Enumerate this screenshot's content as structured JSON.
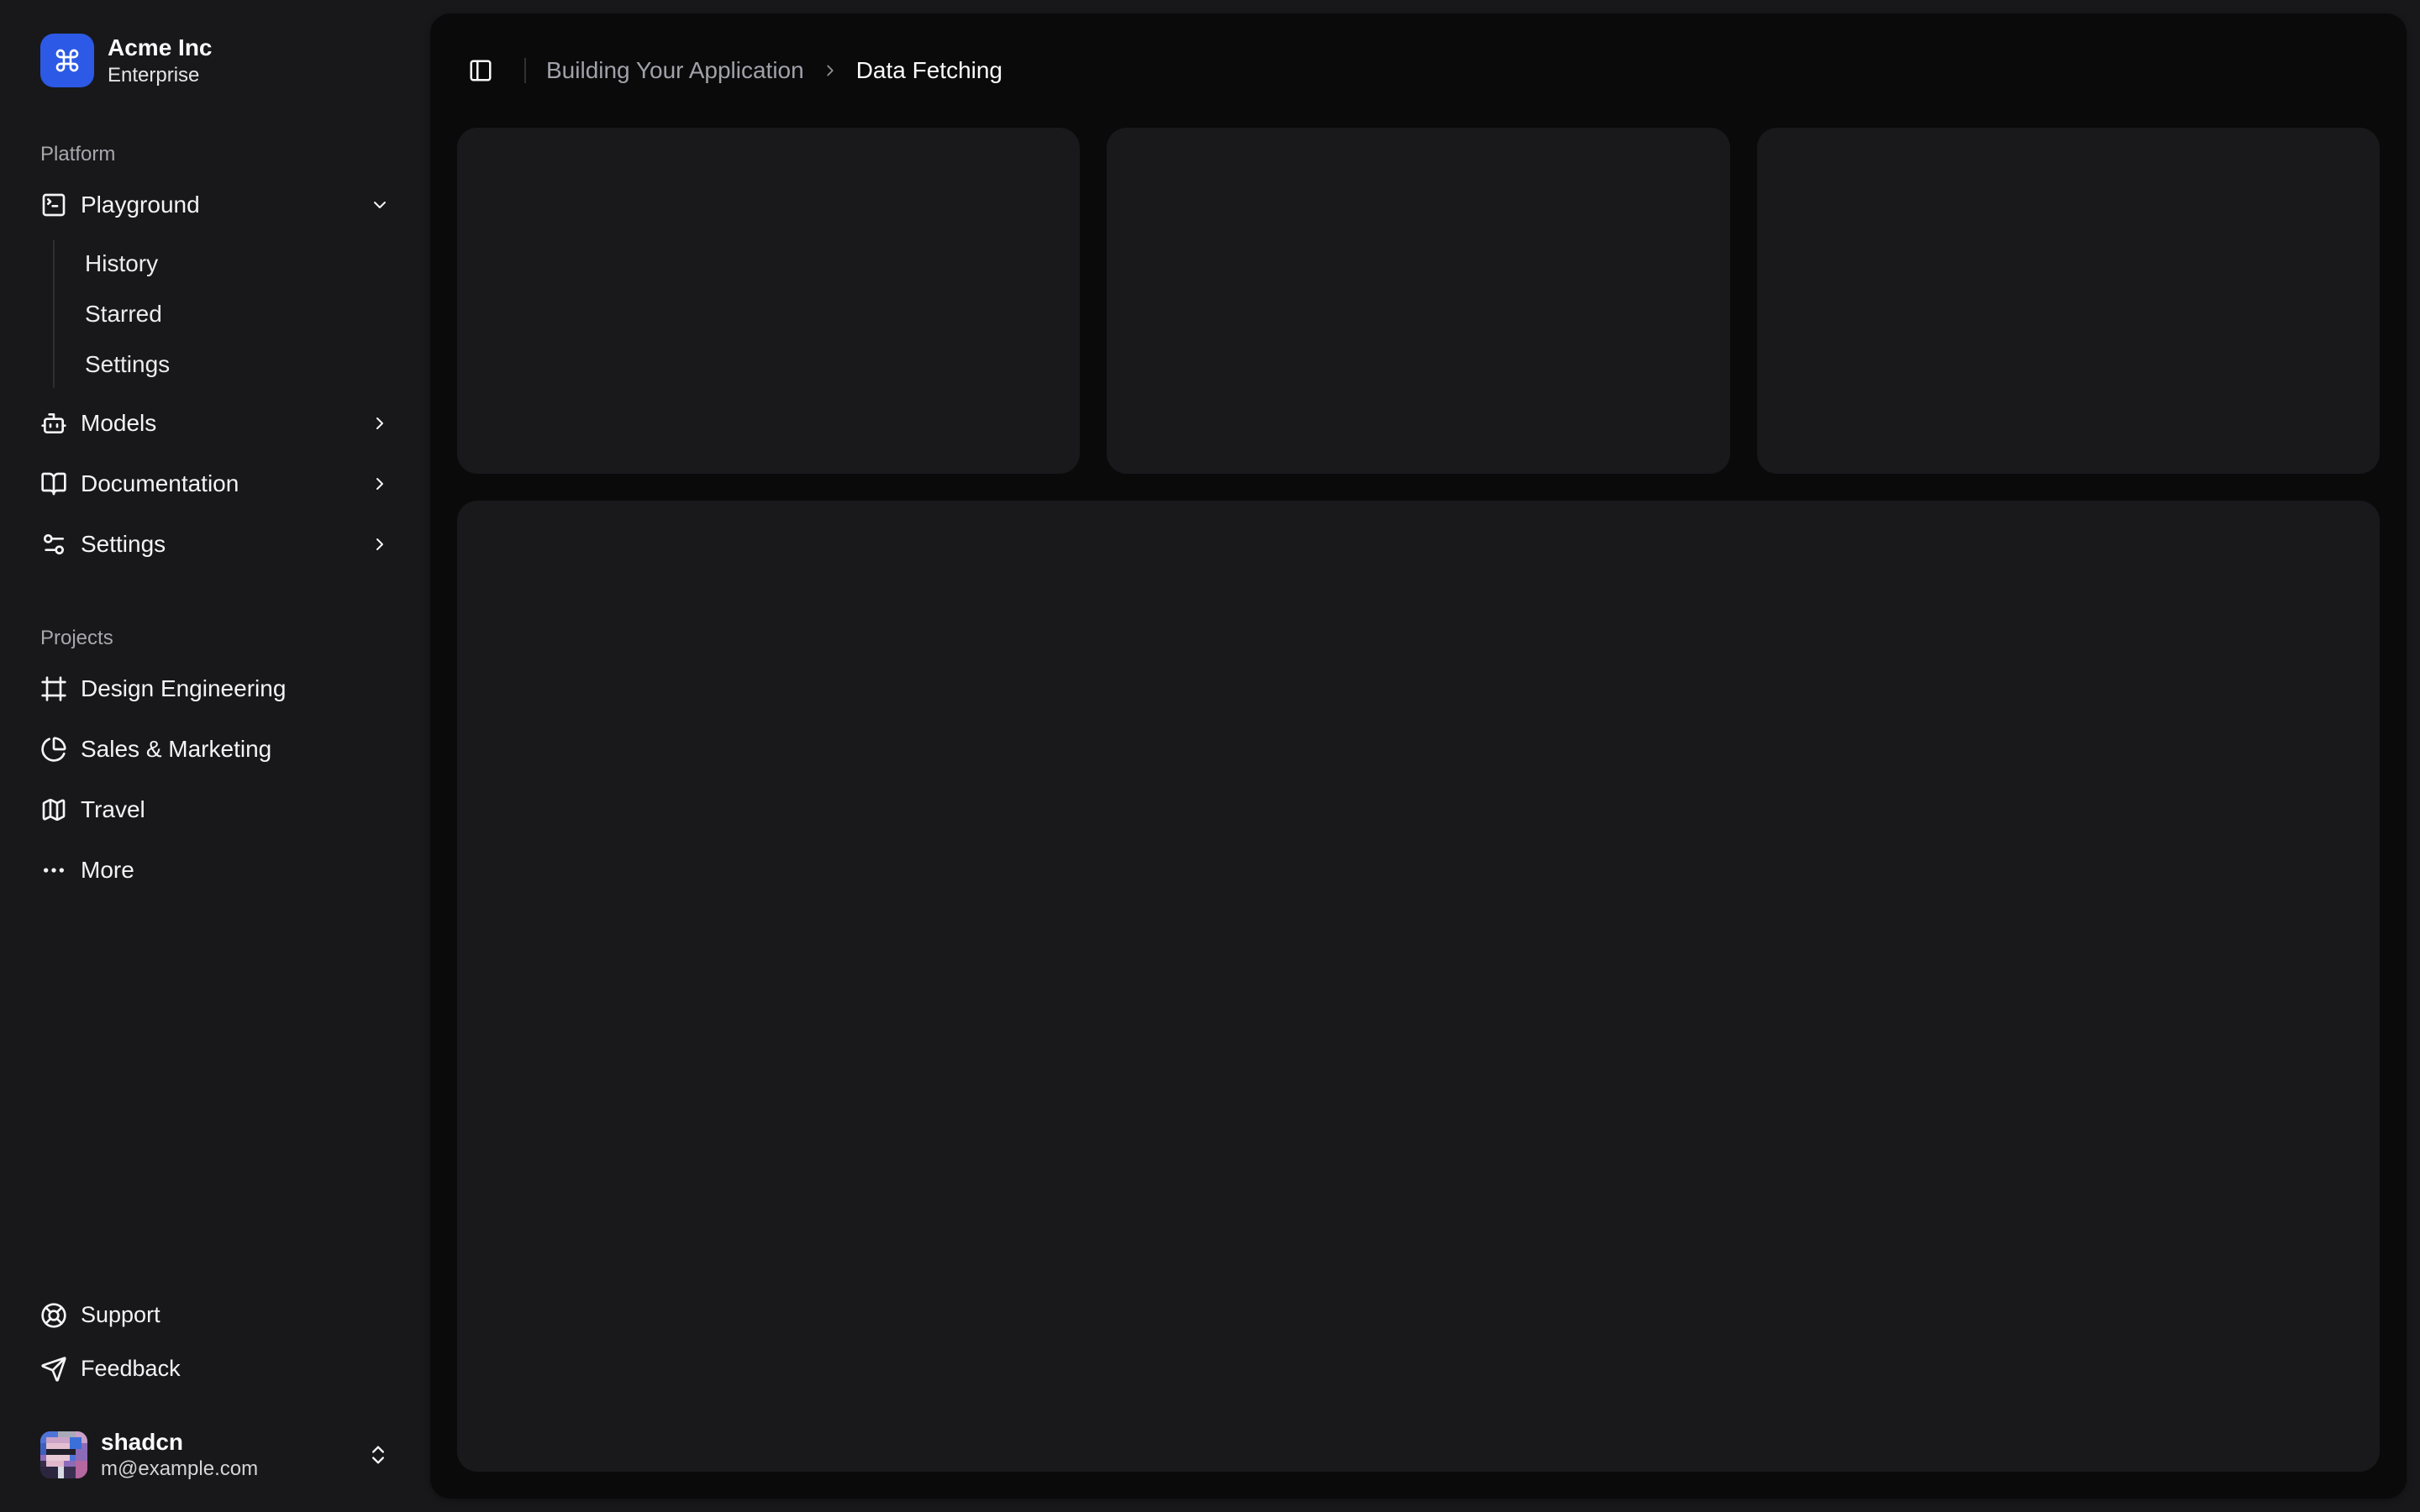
{
  "team": {
    "name": "Acme Inc",
    "plan": "Enterprise",
    "logo_icon": "command-icon"
  },
  "sidebar": {
    "sections": [
      {
        "label": "Platform",
        "items": [
          {
            "label": "Playground",
            "icon": "square-terminal-icon",
            "chevron": "down",
            "expanded": true,
            "children": [
              {
                "label": "History"
              },
              {
                "label": "Starred"
              },
              {
                "label": "Settings"
              }
            ]
          },
          {
            "label": "Models",
            "icon": "bot-icon",
            "chevron": "right"
          },
          {
            "label": "Documentation",
            "icon": "book-open-icon",
            "chevron": "right"
          },
          {
            "label": "Settings",
            "icon": "settings-icon",
            "chevron": "right"
          }
        ]
      },
      {
        "label": "Projects",
        "items": [
          {
            "label": "Design Engineering",
            "icon": "frame-icon"
          },
          {
            "label": "Sales & Marketing",
            "icon": "pie-chart-icon"
          },
          {
            "label": "Travel",
            "icon": "map-icon"
          },
          {
            "label": "More",
            "icon": "ellipsis-icon"
          }
        ]
      }
    ],
    "secondary_items": [
      {
        "label": "Support",
        "icon": "life-buoy-icon"
      },
      {
        "label": "Feedback",
        "icon": "send-icon"
      }
    ]
  },
  "user": {
    "name": "shadcn",
    "email": "m@example.com"
  },
  "header": {
    "breadcrumb": {
      "parent": "Building Your Application",
      "current": "Data Fetching"
    }
  },
  "colors": {
    "brand_blue": "#2c59e5",
    "sidebar_bg": "#18181b",
    "panel_bg": "#0a0a0b",
    "card_bg": "#19191c",
    "foreground": "#fafafa",
    "muted_foreground": "#a1a1aa"
  }
}
